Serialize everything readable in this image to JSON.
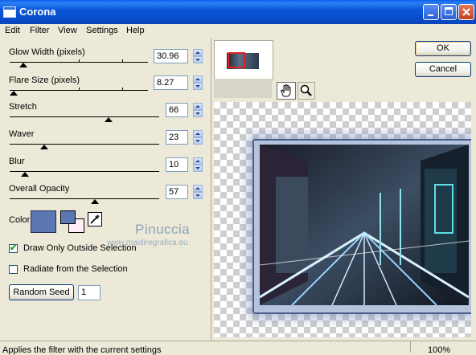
{
  "window": {
    "title": "Corona"
  },
  "menu": [
    "Edit",
    "Filter",
    "View",
    "Settings",
    "Help"
  ],
  "controls": {
    "glow_width": {
      "label": "Glow Width (pixels)",
      "value": "30.96",
      "level": 0.1
    },
    "flare_size": {
      "label": "Flare Size (pixels)",
      "value": "8.27",
      "level": 0.03
    },
    "stretch": {
      "label": "Stretch",
      "value": "66",
      "level": 0.66
    },
    "waver": {
      "label": "Waver",
      "value": "23",
      "level": 0.23
    },
    "blur": {
      "label": "Blur",
      "value": "10",
      "level": 0.1
    },
    "opacity": {
      "label": "Overall Opacity",
      "value": "57",
      "level": 0.57
    }
  },
  "color": {
    "label": "Color",
    "swatch": "#5b77b1"
  },
  "options": {
    "draw_outside": {
      "label": "Draw Only Outside Selection",
      "checked": true
    },
    "radiate": {
      "label": "Radiate from the Selection",
      "checked": false
    }
  },
  "random_seed": {
    "label": "Random Seed",
    "value": "1"
  },
  "buttons": {
    "ok": "OK",
    "cancel": "Cancel"
  },
  "watermark": {
    "name": "Pinuccia",
    "url": "www.maidiregrafica.eu"
  },
  "status": {
    "text": "Applies the filter with the current settings",
    "zoom": "100%"
  }
}
